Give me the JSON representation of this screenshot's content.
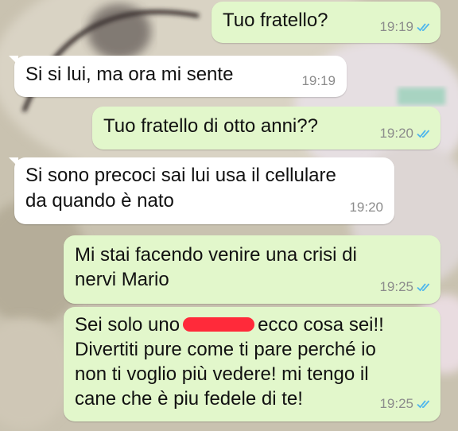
{
  "colors": {
    "outgoing_bubble": "#e2f7cb",
    "incoming_bubble": "#ffffff",
    "read_ticks": "#4fb6ec",
    "redaction": "#ff2a3a"
  },
  "messages": [
    {
      "direction": "outgoing",
      "lines": [
        "Tuo fratello?"
      ],
      "time": "19:19",
      "status_icon": "double-check-read-icon"
    },
    {
      "direction": "incoming",
      "lines": [
        "Si si lui, ma ora mi sente"
      ],
      "time": "19:19"
    },
    {
      "direction": "outgoing",
      "lines": [
        "Tuo fratello di otto anni??"
      ],
      "time": "19:20",
      "status_icon": "double-check-read-icon"
    },
    {
      "direction": "incoming",
      "lines": [
        "Si sono precoci sai lui usa il cellulare",
        "da quando è nato"
      ],
      "time": "19:20"
    },
    {
      "direction": "outgoing",
      "lines": [
        "Mi stai facendo venire una crisi di",
        "nervi Mario"
      ],
      "time": "19:25",
      "status_icon": "double-check-read-icon"
    },
    {
      "direction": "outgoing",
      "line1_before": "Sei solo uno",
      "line1_after": "ecco cosa sei!!",
      "lines": [
        "Divertiti pure come ti pare perché io",
        "non ti voglio più vedere! mi tengo il",
        "cane che è piu fedele di te!"
      ],
      "time": "19:25",
      "status_icon": "double-check-read-icon"
    }
  ]
}
